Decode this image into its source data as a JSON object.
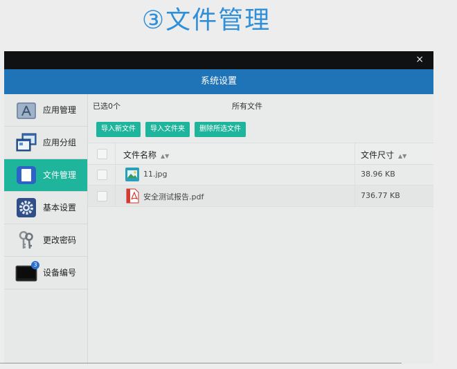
{
  "heading": "③文件管理",
  "window": {
    "close_glyph": "×",
    "title": "系统设置"
  },
  "sidebar": {
    "items": [
      {
        "label": "应用管理",
        "icon": "app-store-icon"
      },
      {
        "label": "应用分组",
        "icon": "windows-group-icon"
      },
      {
        "label": "文件管理",
        "icon": "file-icon",
        "active": true
      },
      {
        "label": "基本设置",
        "icon": "gear-icon"
      },
      {
        "label": "更改密码",
        "icon": "keys-icon"
      },
      {
        "label": "设备编号",
        "icon": "device-icon",
        "badge": "3"
      }
    ]
  },
  "main": {
    "selected_count": "已选0个",
    "all_files": "所有文件",
    "buttons": {
      "import_file": "导入新文件",
      "import_folder": "导入文件夹",
      "delete_selected": "删除所选文件"
    },
    "table": {
      "headers": {
        "name": "文件名称",
        "size": "文件尺寸"
      },
      "rows": [
        {
          "name": "11.jpg",
          "size": "38.96 KB",
          "icon": "image-file-icon"
        },
        {
          "name": "安全测试报告.pdf",
          "size": "736.77 KB",
          "icon": "pdf-file-icon"
        }
      ]
    }
  },
  "colors": {
    "title_bar": "#1f73b7",
    "accent": "#1fb59c",
    "heading": "#2f8fd8"
  }
}
